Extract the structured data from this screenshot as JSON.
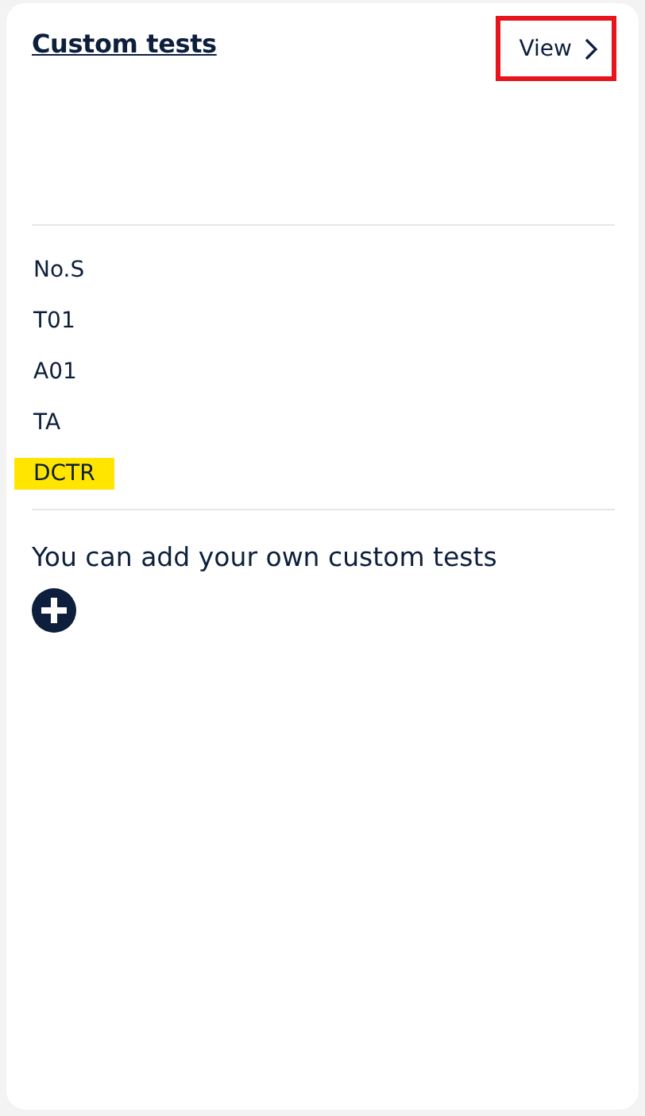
{
  "card": {
    "title": "Custom tests",
    "view_link": {
      "label": "View",
      "highlighted": true
    },
    "tests": [
      {
        "name": "No.S",
        "highlighted": false
      },
      {
        "name": "T01",
        "highlighted": false
      },
      {
        "name": "A01",
        "highlighted": false
      },
      {
        "name": "TA",
        "highlighted": false
      },
      {
        "name": "DCTR",
        "highlighted": true
      }
    ],
    "add_hint": "You can add your own custom tests"
  }
}
